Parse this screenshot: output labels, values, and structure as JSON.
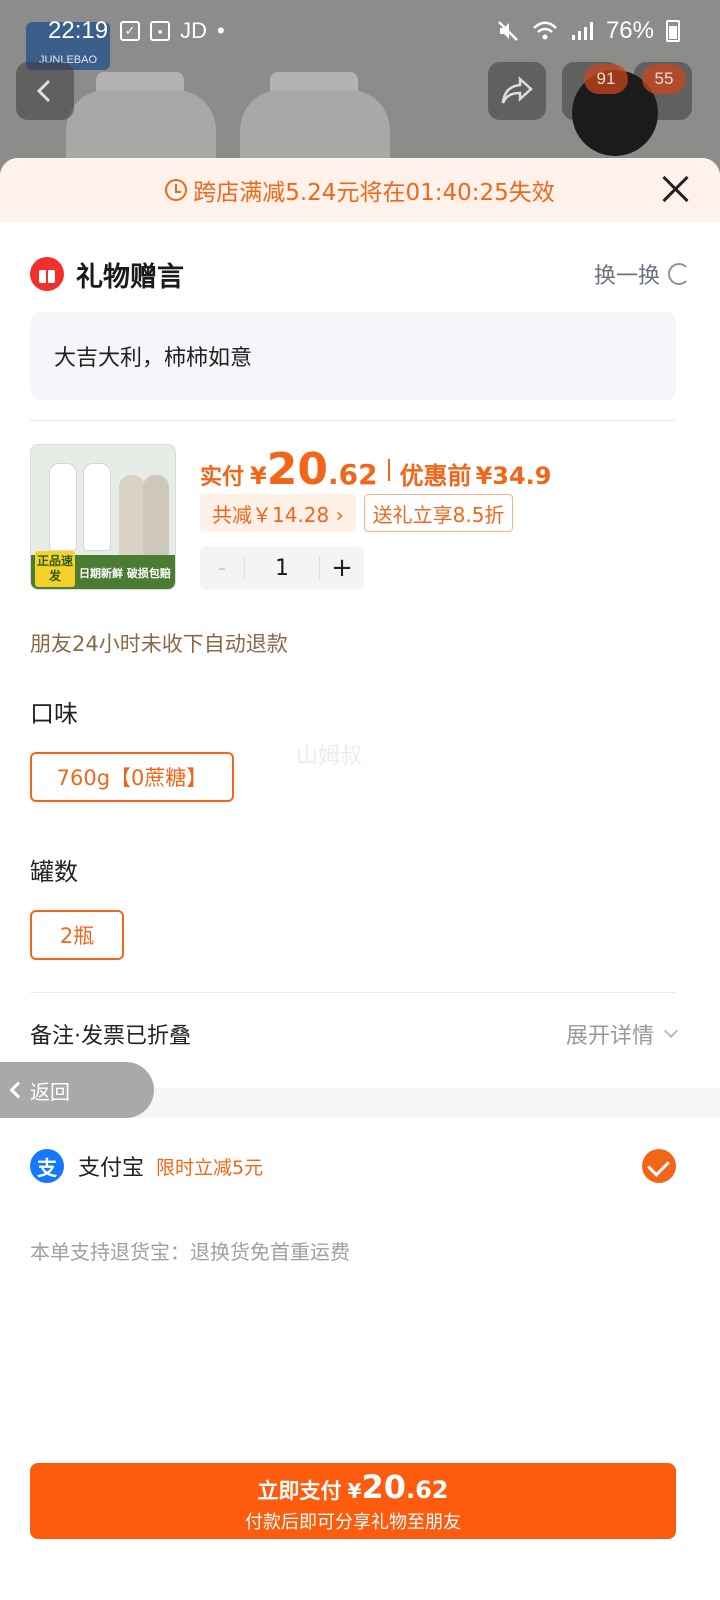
{
  "status_bar": {
    "time": "22:19",
    "app_label": "JD",
    "dot": "•",
    "battery": "76%"
  },
  "background_page": {
    "cart_badge": "91",
    "message_badge": "55",
    "brand": "JUNLEBAO"
  },
  "countdown": {
    "text": "跨店满减5.24元将在01:40:25失效"
  },
  "gift": {
    "title": "礼物赠言",
    "swap_label": "换一换",
    "message": "大吉大利，柿柿如意"
  },
  "product": {
    "tag_text": "正品速发",
    "band_text": "日期新鲜 破损包赔",
    "price_label": "实付",
    "currency": "¥",
    "price_int": "20",
    "price_dec": ".62",
    "before_label": "优惠前",
    "before_price": "¥34.9",
    "discount_tag": "共减￥14.28 ›",
    "gift_tag": "送礼立享8.5折",
    "quantity": "1",
    "minus": "-",
    "plus": "+"
  },
  "refund_note": "朋友24小时未收下自动退款",
  "flavor": {
    "title": "口味",
    "option": "760g【0蔗糖】"
  },
  "watermark": "山姆叔",
  "count": {
    "title": "罐数",
    "option": "2瓶"
  },
  "remark": {
    "label": "备注·发票已折叠",
    "expand": "展开详情"
  },
  "back_label": "返回",
  "payment": {
    "icon_glyph": "支",
    "name": "支付宝",
    "promo": "限时立减5元"
  },
  "return_note": "本单支持退货宝：退换货免首重运费",
  "pay_button": {
    "label": "立即支付",
    "currency": "¥",
    "int": "20",
    "dec": ".62",
    "sub": "付款后即可分享礼物至朋友"
  },
  "colors": {
    "accent": "#f2661a",
    "button": "#fd5b0e",
    "alipay": "#1677ff"
  }
}
